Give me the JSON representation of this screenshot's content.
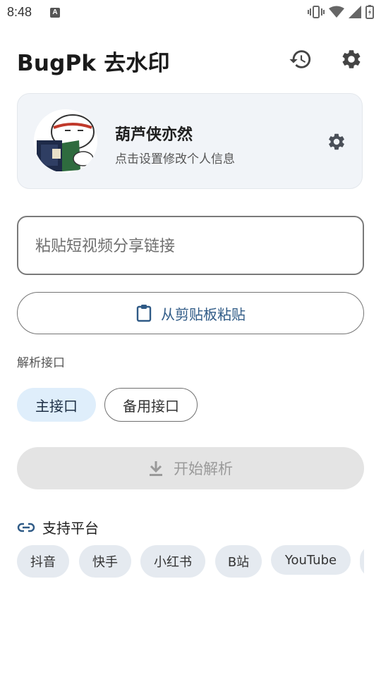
{
  "status_bar": {
    "time": "8:48",
    "notification_icon": "A"
  },
  "header": {
    "title": "BugPk 去水印",
    "history_icon": "history-icon",
    "settings_icon": "gear-icon"
  },
  "profile": {
    "name": "葫芦侠亦然",
    "subtitle": "点击设置修改个人信息"
  },
  "input": {
    "placeholder": "粘贴短视频分享链接",
    "value": ""
  },
  "paste_button": {
    "label": "从剪贴板粘贴"
  },
  "api": {
    "section_label": "解析接口",
    "options": [
      {
        "label": "主接口",
        "selected": true
      },
      {
        "label": "备用接口",
        "selected": false
      }
    ]
  },
  "parse_button": {
    "label": "开始解析",
    "enabled": false
  },
  "platforms": {
    "title": "支持平台",
    "items": [
      "抖音",
      "快手",
      "小红书",
      "B站",
      "YouTube"
    ]
  },
  "colors": {
    "accent": "#2f5a86",
    "chip_selected": "#dfeefb",
    "card_bg": "#f1f4f8"
  }
}
